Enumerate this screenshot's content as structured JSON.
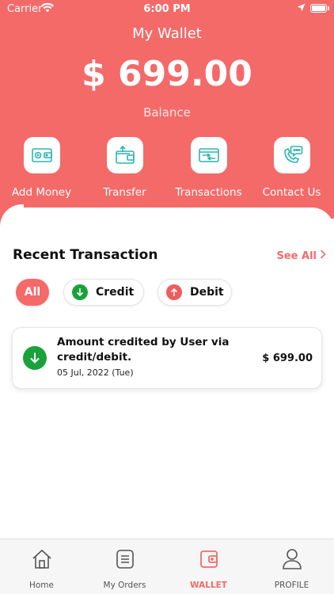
{
  "status_bar": {
    "carrier": "Carrier",
    "time": "6:00 PM"
  },
  "header": {
    "title": "My Wallet",
    "balance": "$ 699.00",
    "balance_label": "Balance",
    "background_color": "#f36a69"
  },
  "actions": [
    {
      "label": "Add Money",
      "icon": "add-money-icon"
    },
    {
      "label": "Transfer",
      "icon": "wallet-transfer-icon"
    },
    {
      "label": "Transactions",
      "icon": "transactions-icon"
    },
    {
      "label": "Contact Us",
      "icon": "contact-phone-icon"
    }
  ],
  "recent": {
    "title": "Recent Transaction",
    "see_all": "See All"
  },
  "filters": {
    "all": "All",
    "credit": "Credit",
    "debit": "Debit"
  },
  "transactions": [
    {
      "description": "Amount credited by User via credit/debit.",
      "date": "05 Jul, 2022 (Tue)",
      "amount": "$ 699.00",
      "type": "credit"
    }
  ],
  "nav": {
    "items": [
      {
        "label": "Home",
        "icon": "home-icon"
      },
      {
        "label": "My Orders",
        "icon": "orders-icon"
      },
      {
        "label": "WALLET",
        "icon": "wallet-icon",
        "active": true
      },
      {
        "label": "PROFILE",
        "icon": "profile-icon"
      }
    ]
  },
  "colors": {
    "accent": "#f36a69",
    "credit": "#1aa13a",
    "debit": "#ee5c5c",
    "icon_teal": "#2bb5b0"
  }
}
